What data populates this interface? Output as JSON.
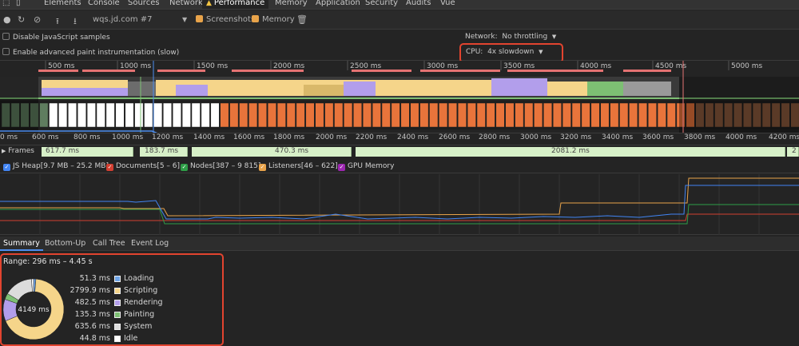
{
  "devtools_tabs": [
    "Elements",
    "Console",
    "Sources",
    "Network",
    "Performance",
    "Memory",
    "Application",
    "Security",
    "Audits",
    "Vue"
  ],
  "active_tab": "Performance",
  "toolbar": {
    "recording_name": "wqs.jd.com #7",
    "screenshots_label": "Screenshots",
    "memory_label": "Memory"
  },
  "settings": {
    "disable_js_samples": "Disable JavaScript samples",
    "enable_paint": "Enable advanced paint instrumentation (slow)",
    "network_label": "Network:",
    "network_value": "No throttling",
    "cpu_label": "CPU:",
    "cpu_value": "4x slowdown"
  },
  "overview_ticks": [
    "500 ms",
    "1000 ms",
    "1500 ms",
    "2000 ms",
    "2500 ms",
    "3000 ms",
    "3500 ms",
    "4000 ms",
    "4500 ms",
    "5000 ms"
  ],
  "time_ticks": [
    "0 ms",
    "600 ms",
    "800 ms",
    "1000 ms",
    "1200 ms",
    "1400 ms",
    "1600 ms",
    "1800 ms",
    "2000 ms",
    "2200 ms",
    "2400 ms",
    "2600 ms",
    "2800 ms",
    "3000 ms",
    "3200 ms",
    "3400 ms",
    "3600 ms",
    "3800 ms",
    "4000 ms",
    "4200 ms"
  ],
  "frames": {
    "label": "Frames",
    "durations": [
      "617.7 ms",
      "183.7 ms",
      "470.3 ms",
      "2081.2 ms",
      "2"
    ]
  },
  "memory_legend": [
    {
      "label": "JS Heap[9.7 MB – 25.2 MB]",
      "color": "#4285f4"
    },
    {
      "label": "Documents[5 – 6]",
      "color": "#d23f31"
    },
    {
      "label": "Nodes[387 – 9 815]",
      "color": "#2e9e47"
    },
    {
      "label": "Listeners[46 – 622]",
      "color": "#e8a34a"
    },
    {
      "label": "GPU Memory",
      "color": "#9c27b0"
    }
  ],
  "bottom_tabs": [
    "Summary",
    "Bottom-Up",
    "Call Tree",
    "Event Log"
  ],
  "summary": {
    "range": "Range: 296 ms – 4.45 s",
    "total": "4149 ms",
    "rows": [
      {
        "value": "51.3 ms",
        "label": "Loading",
        "color": "#6fa5e8",
        "ms": 51.3
      },
      {
        "value": "2799.9 ms",
        "label": "Scripting",
        "color": "#f5d58a",
        "ms": 2799.9
      },
      {
        "value": "482.5 ms",
        "label": "Rendering",
        "color": "#b29eeb",
        "ms": 482.5
      },
      {
        "value": "135.3 ms",
        "label": "Painting",
        "color": "#7dbf73",
        "ms": 135.3
      },
      {
        "value": "635.6 ms",
        "label": "System",
        "color": "#dcdcdc",
        "ms": 635.6
      },
      {
        "value": "44.8 ms",
        "label": "Idle",
        "color": "#ffffff",
        "ms": 44.8
      }
    ]
  }
}
